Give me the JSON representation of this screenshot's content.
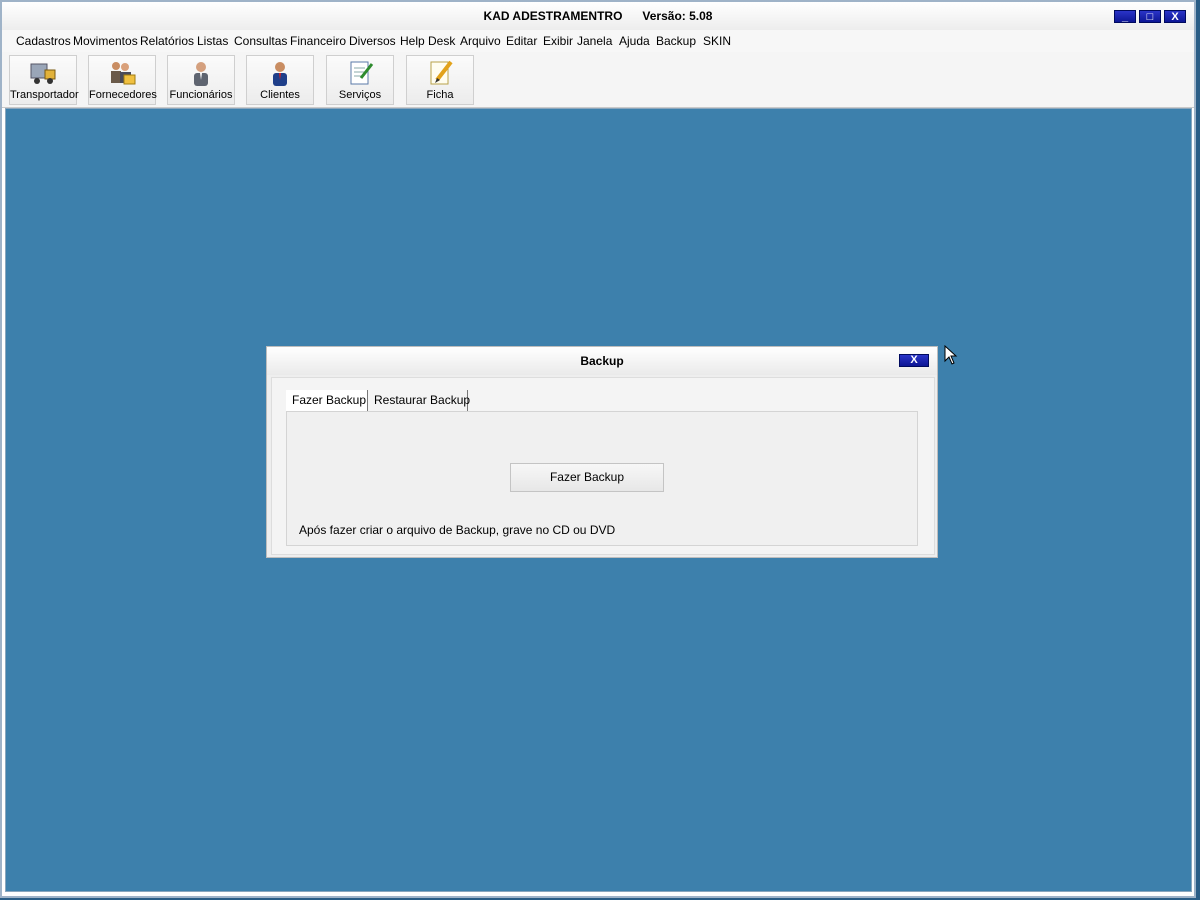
{
  "window": {
    "title": "KAD ADESTRAMENTRO      Versão: 5.08",
    "controls": {
      "minimize": "_",
      "maximize": "□",
      "close": "X"
    }
  },
  "menu": [
    "Cadastros",
    "Movimentos",
    "Relatórios",
    "Listas",
    "Consultas",
    "Financeiro",
    "Diversos",
    "Help Desk",
    "Arquivo",
    "Editar",
    "Exibir",
    "Janela",
    "Ajuda",
    "Backup",
    "SKIN"
  ],
  "toolbar": [
    {
      "label": "Transportador",
      "icon": "truck-icon"
    },
    {
      "label": "Fornecedores",
      "icon": "suppliers-icon"
    },
    {
      "label": "Funcionários",
      "icon": "employee-icon"
    },
    {
      "label": "Clientes",
      "icon": "client-icon"
    },
    {
      "label": "Serviços",
      "icon": "services-document-icon"
    },
    {
      "label": "Ficha",
      "icon": "form-pencil-icon"
    }
  ],
  "dialog": {
    "title": "Backup",
    "close": "X",
    "tabs": [
      "Fazer Backup",
      "Restaurar Backup"
    ],
    "active_tab": "Fazer Backup",
    "button": "Fazer Backup",
    "hint": "Após fazer criar o arquivo de Backup, grave no CD ou DVD"
  }
}
